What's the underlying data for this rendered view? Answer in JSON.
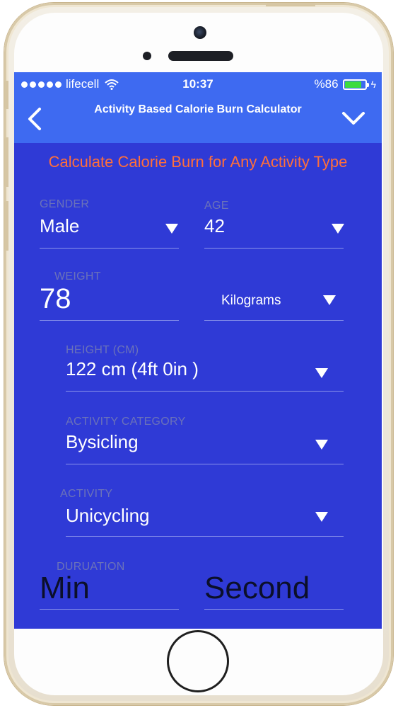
{
  "status_bar": {
    "carrier": "lifecell",
    "time": "10:37",
    "battery": "%86",
    "battery_level": 0.86
  },
  "nav": {
    "back_icon": "chevron-left-icon",
    "title": "Activity Based Calorie Burn Calculator",
    "dropdown_icon": "chevron-down-icon"
  },
  "headline": "Calculate Calorie Burn for Any Activity Type",
  "form": {
    "gender": {
      "label": "GENDER",
      "value": "Male"
    },
    "age": {
      "label": "AGE",
      "value": "42"
    },
    "weight": {
      "label": "WEIGHT",
      "value": "78",
      "unit": "Kilograms"
    },
    "height": {
      "label": "HEIGHT (CM)",
      "value": "122 cm (4ft 0in )"
    },
    "activity_category": {
      "label": "ACTIVITY CATEGORY",
      "value": "Bysicling"
    },
    "activity": {
      "label": "ACTIVITY",
      "value": "Unicycling"
    },
    "duration": {
      "label": "DURUATION",
      "min_placeholder": "Min",
      "second_placeholder": "Second"
    }
  },
  "colors": {
    "nav_bg": "#3e6af1",
    "screen_bg": "#2f3ad6",
    "headline": "#ff6f3a"
  }
}
